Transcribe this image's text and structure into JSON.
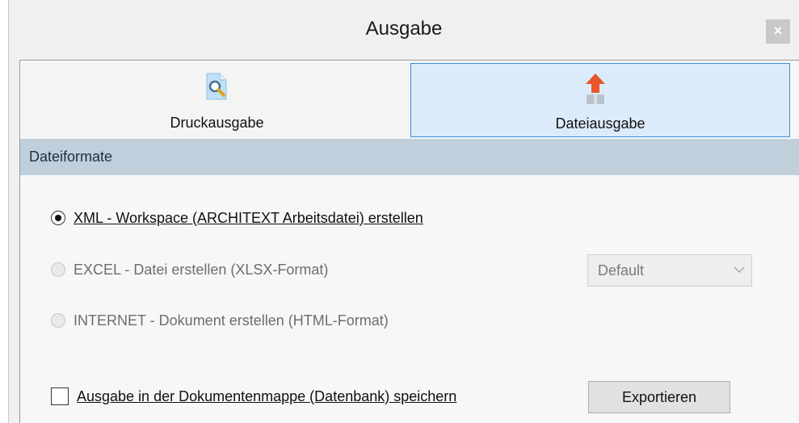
{
  "window": {
    "title": "Ausgabe",
    "close_symbol": "×"
  },
  "tabs": [
    {
      "label": "Druckausgabe",
      "icon": "print-preview-icon",
      "selected": false
    },
    {
      "label": "Dateiausgabe",
      "icon": "file-export-icon",
      "selected": true
    }
  ],
  "section": {
    "title": "Dateiformate"
  },
  "options": [
    {
      "label": "XML - Workspace (ARCHITEXT Arbeitsdatei) erstellen",
      "checked": true,
      "enabled": true
    },
    {
      "label": "EXCEL - Datei erstellen (XLSX-Format)",
      "checked": false,
      "enabled": false
    },
    {
      "label": "INTERNET - Dokument erstellen (HTML-Format)",
      "checked": false,
      "enabled": false
    }
  ],
  "format_select": {
    "value": "Default",
    "enabled": false
  },
  "save_checkbox": {
    "label": "Ausgabe in der Dokumentenmappe (Datenbank) speichern",
    "checked": false
  },
  "export_button": {
    "label": "Exportieren"
  },
  "colors": {
    "selected_tab_bg": "#dcebfa",
    "selected_tab_border": "#3b8fd8",
    "section_header_bg": "#bfcfdc",
    "export_arrow": "#e8572a"
  }
}
